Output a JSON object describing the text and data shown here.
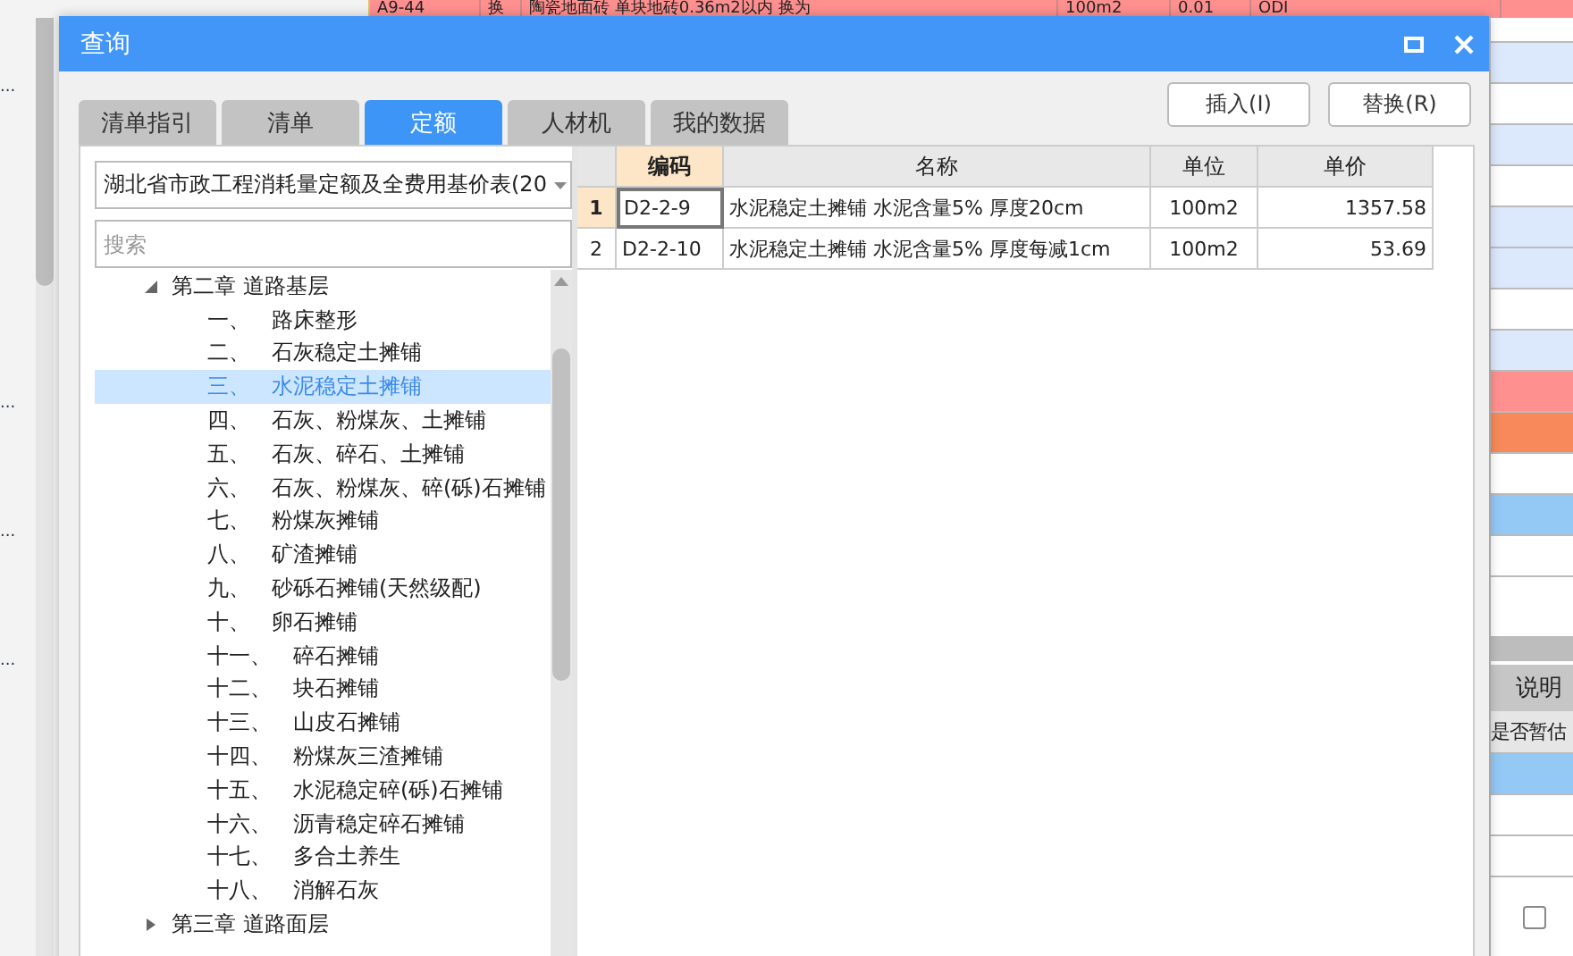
{
  "background": {
    "top_row": [
      "A9-44",
      "换",
      "陶瓷地面砖 单块地砖0.36m2以内 换为",
      "100m2",
      "0.01",
      "ODI"
    ],
    "left_marks": [
      "...",
      "...",
      "...",
      "..."
    ],
    "side_rows": [
      {
        "color": "#ffffff"
      },
      {
        "color": "#dce8fb"
      },
      {
        "color": "#ffffff"
      },
      {
        "color": "#dce8fb"
      },
      {
        "color": "#ffffff"
      },
      {
        "color": "#dce8fb"
      },
      {
        "color": "#dce8fb"
      },
      {
        "color": "#ffffff"
      },
      {
        "color": "#dce8fb"
      },
      {
        "color": "#ff9090"
      },
      {
        "color": "#f7895a"
      },
      {
        "color": "#ffffff"
      },
      {
        "color": "#94c8f5"
      },
      {
        "color": "#ffffff"
      },
      {
        "color": "#ffffff"
      }
    ],
    "side_header": "说明",
    "side_cell": "是否暂估",
    "side_lower_rows": [
      {
        "color": "#94c8f5"
      },
      {
        "color": "#ffffff"
      },
      {
        "color": "#ffffff"
      }
    ],
    "side_checkbox": {
      "checked": false
    }
  },
  "dialog": {
    "title": "查询",
    "tabs": [
      {
        "label": "清单指引",
        "selected": false
      },
      {
        "label": "清单",
        "selected": false
      },
      {
        "label": "定额",
        "selected": true
      },
      {
        "label": "人材机",
        "selected": false
      },
      {
        "label": "我的数据",
        "selected": false
      }
    ],
    "buttons": [
      "插入(I)",
      "替换(R)"
    ],
    "library": "湖北省市政工程消耗量定额及全费用基价表(20",
    "search": {
      "placeholder": "搜索"
    },
    "tree": [
      {
        "label": "第二章 道路基层",
        "expanded": true,
        "children": [
          {
            "number": "一、",
            "label": "路床整形",
            "selected": false
          },
          {
            "number": "二、",
            "label": "石灰稳定土摊铺",
            "selected": false
          },
          {
            "number": "三、",
            "label": "水泥稳定土摊铺",
            "selected": true
          },
          {
            "number": "四、",
            "label": "石灰、粉煤灰、土摊铺",
            "selected": false
          },
          {
            "number": "五、",
            "label": "石灰、碎石、土摊铺",
            "selected": false
          },
          {
            "number": "六、",
            "label": "石灰、粉煤灰、碎(砾)石摊铺",
            "selected": false
          },
          {
            "number": "七、",
            "label": "粉煤灰摊铺",
            "selected": false
          },
          {
            "number": "八、",
            "label": "矿渣摊铺",
            "selected": false
          },
          {
            "number": "九、",
            "label": "砂砾石摊铺(天然级配)",
            "selected": false
          },
          {
            "number": "十、",
            "label": "卵石摊铺",
            "selected": false
          },
          {
            "number": "十一、",
            "label": "碎石摊铺",
            "selected": false
          },
          {
            "number": "十二、",
            "label": "块石摊铺",
            "selected": false
          },
          {
            "number": "十三、",
            "label": "山皮石摊铺",
            "selected": false
          },
          {
            "number": "十四、",
            "label": "粉煤灰三渣摊铺",
            "selected": false
          },
          {
            "number": "十五、",
            "label": "水泥稳定碎(砾)石摊铺",
            "selected": false
          },
          {
            "number": "十六、",
            "label": "沥青稳定碎石摊铺",
            "selected": false
          },
          {
            "number": "十七、",
            "label": "多合土养生",
            "selected": false
          },
          {
            "number": "十八、",
            "label": "消解石灰",
            "selected": false
          }
        ]
      },
      {
        "label": "第三章 道路面层",
        "expanded": false
      }
    ],
    "table": {
      "columns": [
        "编码",
        "名称",
        "单位",
        "单价"
      ],
      "rows": [
        {
          "index": "1",
          "selected": true,
          "cells": [
            "D2-2-9",
            "水泥稳定土摊铺 水泥含量5% 厚度20cm",
            "100m2",
            "1357.58"
          ]
        },
        {
          "index": "2",
          "selected": false,
          "cells": [
            "D2-2-10",
            "水泥稳定土摊铺 水泥含量5% 厚度每减1cm",
            "100m2",
            "53.69"
          ]
        }
      ]
    }
  }
}
